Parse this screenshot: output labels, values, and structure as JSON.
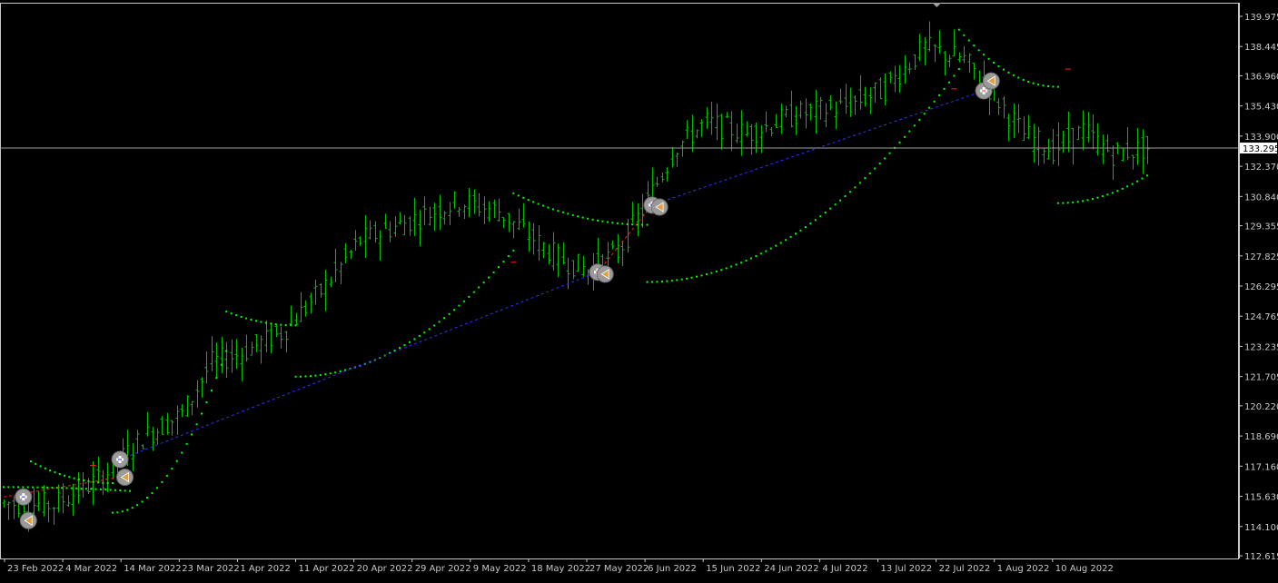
{
  "chart_data": {
    "type": "ohlc",
    "y_axis_labels": [
      "139.975",
      "138.445",
      "136.960",
      "135.430",
      "133.900",
      "132.370",
      "130.840",
      "129.355",
      "127.825",
      "126.295",
      "124.765",
      "123.235",
      "121.705",
      "120.220",
      "118.690",
      "117.160",
      "115.630",
      "114.100",
      "112.615"
    ],
    "x_axis_labels": [
      "23 Feb 2022",
      "4 Mar 2022",
      "14 Mar 2022",
      "23 Mar 2022",
      "1 Apr 2022",
      "11 Apr 2022",
      "20 Apr 2022",
      "29 Apr 2022",
      "9 May 2022",
      "18 May 2022",
      "27 May 2022",
      "6 Jun 2022",
      "15 Jun 2022",
      "24 Jun 2022",
      "4 Jul 2022",
      "13 Jul 2022",
      "22 Jul 2022",
      "1 Aug 2022",
      "10 Aug 2022"
    ],
    "current_price": "133.295",
    "ylim": [
      112.615,
      139.975
    ],
    "grid": false,
    "colors": {
      "bars": "#00c000",
      "sar_dots": "#00ff00",
      "axis": "#c8c8c8",
      "price_line": "#a0a0a0",
      "buy_trend": "#3030ff",
      "sell_trend": "#ff2020",
      "signal_marker": "#9a9a9a"
    },
    "sar_segments": [
      {
        "trend": "up",
        "start": [
          0.0,
          116.1
        ],
        "end": [
          25.5,
          115.9
        ]
      },
      {
        "trend": "down",
        "start": [
          5.5,
          117.4
        ],
        "end": [
          22.0,
          116.3
        ]
      },
      {
        "trend": "up",
        "start": [
          22.0,
          114.8
        ],
        "end": [
          45.0,
          123.0
        ]
      },
      {
        "trend": "down",
        "start": [
          45.0,
          125.0
        ],
        "end": [
          59.0,
          124.3
        ]
      },
      {
        "trend": "up",
        "start": [
          59.0,
          121.7
        ],
        "end": [
          103.0,
          128.1
        ]
      },
      {
        "trend": "down",
        "start": [
          103.0,
          131.0
        ],
        "end": [
          130.0,
          129.4
        ]
      },
      {
        "trend": "up",
        "start": [
          130.0,
          126.5
        ],
        "end": [
          193.0,
          137.3
        ]
      },
      {
        "trend": "down",
        "start": [
          193.0,
          139.3
        ],
        "end": [
          213.0,
          136.4
        ]
      },
      {
        "trend": "up",
        "start": [
          213.0,
          130.5
        ],
        "end": [
          231.0,
          131.9
        ]
      }
    ],
    "signal_markers": [
      {
        "kind": "buy",
        "x": 4.0,
        "y": 115.6
      },
      {
        "kind": "close",
        "x": 5.0,
        "y": 114.4
      },
      {
        "kind": "buy",
        "x": 23.5,
        "y": 117.5
      },
      {
        "kind": "close",
        "x": 24.5,
        "y": 116.6
      },
      {
        "kind": "sell",
        "x": 120.0,
        "y": 127.0
      },
      {
        "kind": "close",
        "x": 121.5,
        "y": 126.9
      },
      {
        "kind": "buy",
        "x": 131.0,
        "y": 130.4
      },
      {
        "kind": "close",
        "x": 132.5,
        "y": 130.3
      },
      {
        "kind": "sell",
        "x": 198.0,
        "y": 136.2
      },
      {
        "kind": "close",
        "x": 199.5,
        "y": 136.7
      }
    ],
    "trend_lines": [
      {
        "kind": "sell",
        "from": [
          0,
          115.6
        ],
        "to": [
          23.5,
          116.6
        ]
      },
      {
        "kind": "buy",
        "from": [
          23.5,
          117.5
        ],
        "to": [
          120.0,
          127.0
        ]
      },
      {
        "kind": "sell",
        "from": [
          120.0,
          127.0
        ],
        "to": [
          131.0,
          130.4
        ]
      },
      {
        "kind": "buy",
        "from": [
          131.0,
          130.4
        ],
        "to": [
          198.0,
          136.2
        ]
      }
    ],
    "dash_marks": [
      {
        "x": 18.0,
        "y": 117.2
      },
      {
        "x": 103.0,
        "y": 127.5
      },
      {
        "x": 192.0,
        "y": 136.3
      },
      {
        "x": 215.0,
        "y": 137.3
      }
    ],
    "window_marker_x": 188.5
  }
}
